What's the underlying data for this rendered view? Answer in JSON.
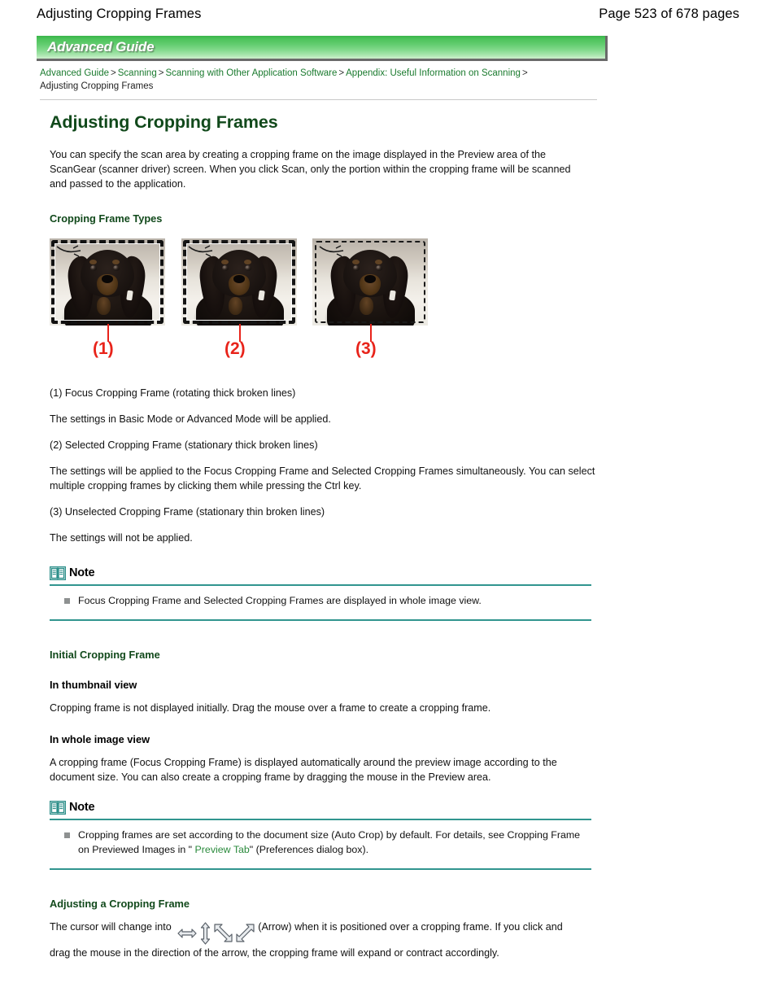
{
  "header": {
    "title": "Adjusting Cropping Frames",
    "page_indicator": "Page 523 of 678 pages"
  },
  "banner": {
    "label": "Advanced Guide",
    "accent_color": "#4dc35b"
  },
  "breadcrumb": {
    "items": [
      {
        "label": "Advanced Guide",
        "link": true
      },
      {
        "label": "Scanning",
        "link": true
      },
      {
        "label": "Scanning with Other Application Software",
        "link": true
      },
      {
        "label": "Appendix: Useful Information on Scanning",
        "link": true
      },
      {
        "label": "Adjusting Cropping Frames",
        "link": false
      }
    ],
    "separator": ">",
    "link_color": "#1a7a2e"
  },
  "main": {
    "title": "Adjusting Cropping Frames",
    "intro": "You can specify the scan area by creating a cropping frame on the image displayed in the Preview area of the ScanGear (scanner driver) screen. When you click Scan, only the portion within the cropping frame will be scanned and passed to the application.",
    "section_frame_types": {
      "heading": "Cropping Frame Types",
      "figure": {
        "callouts": [
          "(1)",
          "(2)",
          "(3)"
        ],
        "callout_color": "#e8231a",
        "images": [
          {
            "caption_ref": "(1)",
            "frame_style": "thick broken lines (rotating)"
          },
          {
            "caption_ref": "(2)",
            "frame_style": "thick broken lines (stationary)"
          },
          {
            "caption_ref": "(3)",
            "frame_style": "thin broken lines (stationary)"
          }
        ]
      },
      "items": [
        "(1) Focus Cropping Frame (rotating thick broken lines)",
        "The settings in Basic Mode or Advanced Mode will be applied.",
        "(2) Selected Cropping Frame (stationary thick broken lines)",
        "The settings will be applied to the Focus Cropping Frame and Selected Cropping Frames simultaneously. You can select multiple cropping frames by clicking them while pressing the Ctrl key.",
        "(3) Unselected Cropping Frame (stationary thin broken lines)",
        "The settings will not be applied."
      ],
      "note": {
        "title": "Note",
        "items": [
          "Focus Cropping Frame and Selected Cropping Frames are displayed in whole image view."
        ],
        "rule_color": "#31958f"
      }
    },
    "section_initial_frame": {
      "heading": "Initial Cropping Frame",
      "sub_thumbnail": {
        "heading": "In thumbnail view",
        "text": "Cropping frame is not displayed initially. Drag the mouse over a frame to create a cropping frame."
      },
      "sub_whole": {
        "heading": "In whole image view",
        "text": "A cropping frame (Focus Cropping Frame) is displayed automatically around the preview image according to the document size. You can also create a cropping frame by dragging the mouse in the Preview area."
      },
      "note": {
        "title": "Note",
        "text_before_link": "Cropping frames are set according to the document size (Auto Crop) by default. For details, see Cropping Frame on Previewed Images in \" ",
        "link_label": "Preview Tab",
        "text_after_link": "\" (Preferences dialog box).",
        "link_color": "#2a8a3c",
        "rule_color": "#31958f"
      }
    },
    "section_adjusting": {
      "heading": "Adjusting a Cropping Frame",
      "text_before_icons": "The cursor will change into",
      "cursor_icons": [
        "resize-horizontal-cursor-icon",
        "resize-vertical-cursor-icon",
        "resize-nwse-cursor-icon",
        "resize-nesw-cursor-icon"
      ],
      "text_after_icons": "(Arrow) when it is positioned over a cropping frame. If you click and drag the mouse in the direction of the arrow, the cropping frame will expand or contract accordingly."
    }
  }
}
